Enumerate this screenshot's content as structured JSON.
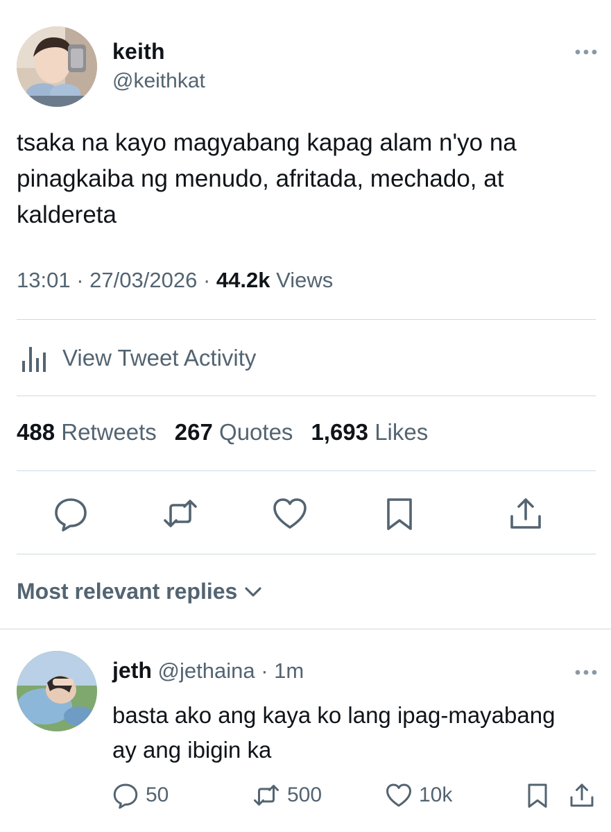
{
  "tweet": {
    "display_name": "keith",
    "handle": "@keithkat",
    "text": "tsaka na kayo magyabang kapag alam n'yo na pinagkaiba ng menudo, afritada, mechado, at kaldereta",
    "time": "13:01",
    "date": "27/03/2026",
    "views_count": "44.2k",
    "views_label": "Views",
    "separator": "·"
  },
  "activity": {
    "label": "View Tweet Activity",
    "icon": "bar-chart-icon"
  },
  "stats": [
    {
      "count": "488",
      "label": "Retweets"
    },
    {
      "count": "267",
      "label": "Quotes"
    },
    {
      "count": "1,693",
      "label": "Likes"
    }
  ],
  "actions": [
    {
      "name": "reply",
      "icon": "comment-icon"
    },
    {
      "name": "retweet",
      "icon": "retweet-icon"
    },
    {
      "name": "like",
      "icon": "heart-icon"
    },
    {
      "name": "bookmark",
      "icon": "bookmark-icon"
    },
    {
      "name": "share",
      "icon": "share-icon"
    }
  ],
  "replies_sort": {
    "label": "Most relevant replies",
    "icon": "chevron-down-icon"
  },
  "reply": {
    "display_name": "jeth",
    "handle": "@jethaina",
    "separator": "·",
    "age": "1m",
    "text": "basta ako ang kaya ko lang ipag-mayabang ay ang ibigin ka",
    "reply_count": "50",
    "retweet_count": "500",
    "like_count": "10k"
  },
  "colors": {
    "text_primary": "#0f1419",
    "text_secondary": "#536471",
    "divider": "#cfd9de"
  }
}
